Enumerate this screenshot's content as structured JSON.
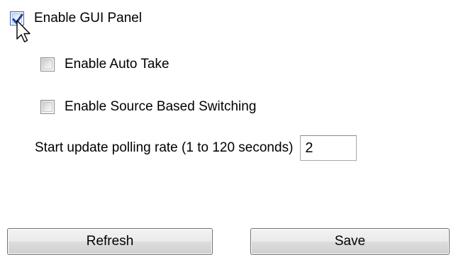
{
  "panel": {
    "enable_gui_panel": {
      "label": "Enable GUI Panel",
      "checked": true
    },
    "enable_auto_take": {
      "label": "Enable Auto Take",
      "checked": false
    },
    "enable_source_based_switching": {
      "label": "Enable Source Based Switching",
      "checked": false
    },
    "polling": {
      "label": "Start update polling rate (1 to 120 seconds)",
      "value": "2"
    }
  },
  "buttons": {
    "refresh_label": "Refresh",
    "save_label": "Save"
  },
  "colors": {
    "checkmark": "#1f3f99",
    "checkbox_border": "#8c8c8c",
    "button_border": "#707070"
  },
  "icons": {
    "cursor": "mouse-pointer-arrow-icon",
    "check": "checkmark-icon"
  }
}
